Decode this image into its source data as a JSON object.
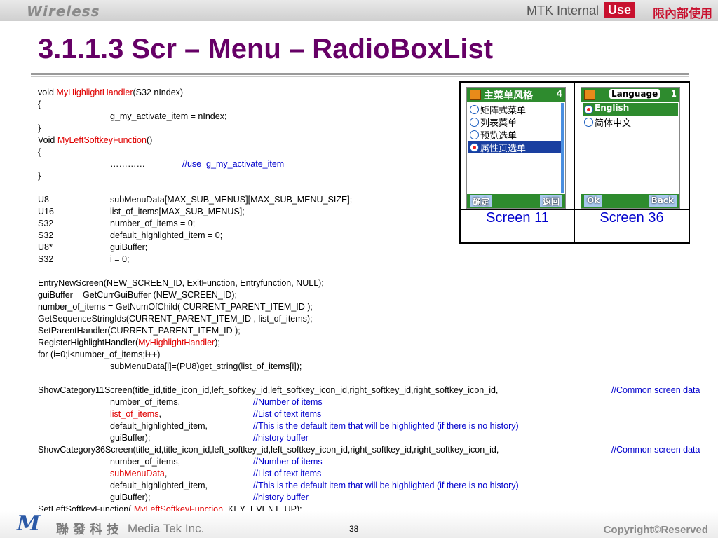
{
  "header": {
    "brand": "Wireless",
    "internal": "MTK Internal",
    "use": "Use",
    "restriction": "限內部使用"
  },
  "slide": {
    "title": "3.1.1.3 Scr – Menu – RadioBoxList"
  },
  "code": {
    "l1": {
      "a": "void ",
      "fn": "MyHighlightHandler",
      "b": "(S32 nIndex)"
    },
    "l2": "{",
    "l3": "g_my_activate_item = nIndex;",
    "l4": "}",
    "l5": {
      "a": "Void ",
      "fn": "MyLeftSoftkeyFunction",
      "b": "()"
    },
    "l6": "{",
    "l7": {
      "dots": "…………",
      "comment": "//use  g_my_activate_item"
    },
    "l8": "}",
    "decls": [
      {
        "type": "U8",
        "decl": "subMenuData[MAX_SUB_MENUS][MAX_SUB_MENU_SIZE];"
      },
      {
        "type": "U16",
        "decl": "list_of_items[MAX_SUB_MENUS];"
      },
      {
        "type": "S32",
        "decl": "number_of_items = 0;"
      },
      {
        "type": "S32",
        "decl": "default_highlighted_item = 0;"
      },
      {
        "type": "U8*",
        "decl": "guiBuffer;"
      },
      {
        "type": "S32",
        "decl": "i = 0;"
      }
    ],
    "s1": "EntryNewScreen(NEW_SCREEN_ID, ExitFunction, Entryfunction, NULL);",
    "s2": "guiBuffer = GetCurrGuiBuffer (NEW_SCREEN_ID);",
    "s3": "number_of_items = GetNumOfChild( CURRENT_PARENT_ITEM_ID );",
    "s4": "GetSequenceStringIds(CURRENT_PARENT_ITEM_ID , list_of_items);",
    "s5": "SetParentHandler(CURRENT_PARENT_ITEM_ID );",
    "s6": {
      "a": "RegisterHighlightHandler(",
      "fn": "MyHighlightHandler",
      "b": ");"
    },
    "s7": "for (i=0;i<number_of_items;i++)",
    "s8": "subMenuData[i]=(PU8)get_string(list_of_items[i]);",
    "cat11": "ShowCategory11Screen(title_id,title_icon_id,left_softkey_id,left_softkey_icon_id,right_softkey_id,right_softkey_icon_id,",
    "cat36": "ShowCategory36Screen(title_id,title_icon_id,left_softkey_id,left_softkey_icon_id,right_softkey_id,right_softkey_icon_id,",
    "common": "//Common screen data",
    "args11": [
      {
        "arg": "number_of_items,",
        "red": "",
        "comma": "",
        "comment": "//Number of items"
      },
      {
        "arg": "",
        "red": "list_of_items",
        "comma": ",",
        "comment": "//List of text items"
      },
      {
        "arg": "default_highlighted_item,",
        "red": "",
        "comma": "",
        "comment": "//This is the default item that will be highlighted (if there is no history)"
      },
      {
        "arg": "guiBuffer);",
        "red": "",
        "comma": "",
        "comment": "//history buffer"
      }
    ],
    "args36": [
      {
        "arg": "number_of_items,",
        "red": "",
        "comma": "",
        "comment": "//Number of items"
      },
      {
        "arg": "",
        "red": "subMenuData",
        "comma": ",",
        "comment": "//List of text items"
      },
      {
        "arg": "default_highlighted_item,",
        "red": "",
        "comma": "",
        "comment": "//This is the default item that will be highlighted (if there is no history)"
      },
      {
        "arg": "guiBuffer);",
        "red": "",
        "comma": "",
        "comment": "//history buffer"
      }
    ],
    "last": {
      "a": "SetLeftSoftkeyFunction( ",
      "fn": "MyLeftSoftkeyFunction",
      "b": ", KEY_EVENT_UP);"
    }
  },
  "screens": {
    "s11": {
      "caption": "Screen 11",
      "title": "主菜单风格",
      "count": "4",
      "items": [
        "矩阵式菜单",
        "列表菜单",
        "预览选单",
        "属性页选单"
      ],
      "selected_index": 3,
      "lsk": "确定",
      "rsk": "返回"
    },
    "s36": {
      "caption": "Screen 36",
      "title": "Language",
      "count": "1",
      "items": [
        "English",
        "简体中文"
      ],
      "selected_index": 0,
      "lsk": "Ok",
      "rsk": "Back"
    }
  },
  "footer": {
    "logo_m": "M",
    "logo_cn": "聯發科技",
    "logo_en": "Media Tek Inc.",
    "page": "38",
    "copyright": "Copyright©Reserved"
  },
  "colors": {
    "title": "#660066",
    "code_comment": "#0000cc",
    "code_function": "#e00000",
    "brand_red": "#c8102e"
  }
}
